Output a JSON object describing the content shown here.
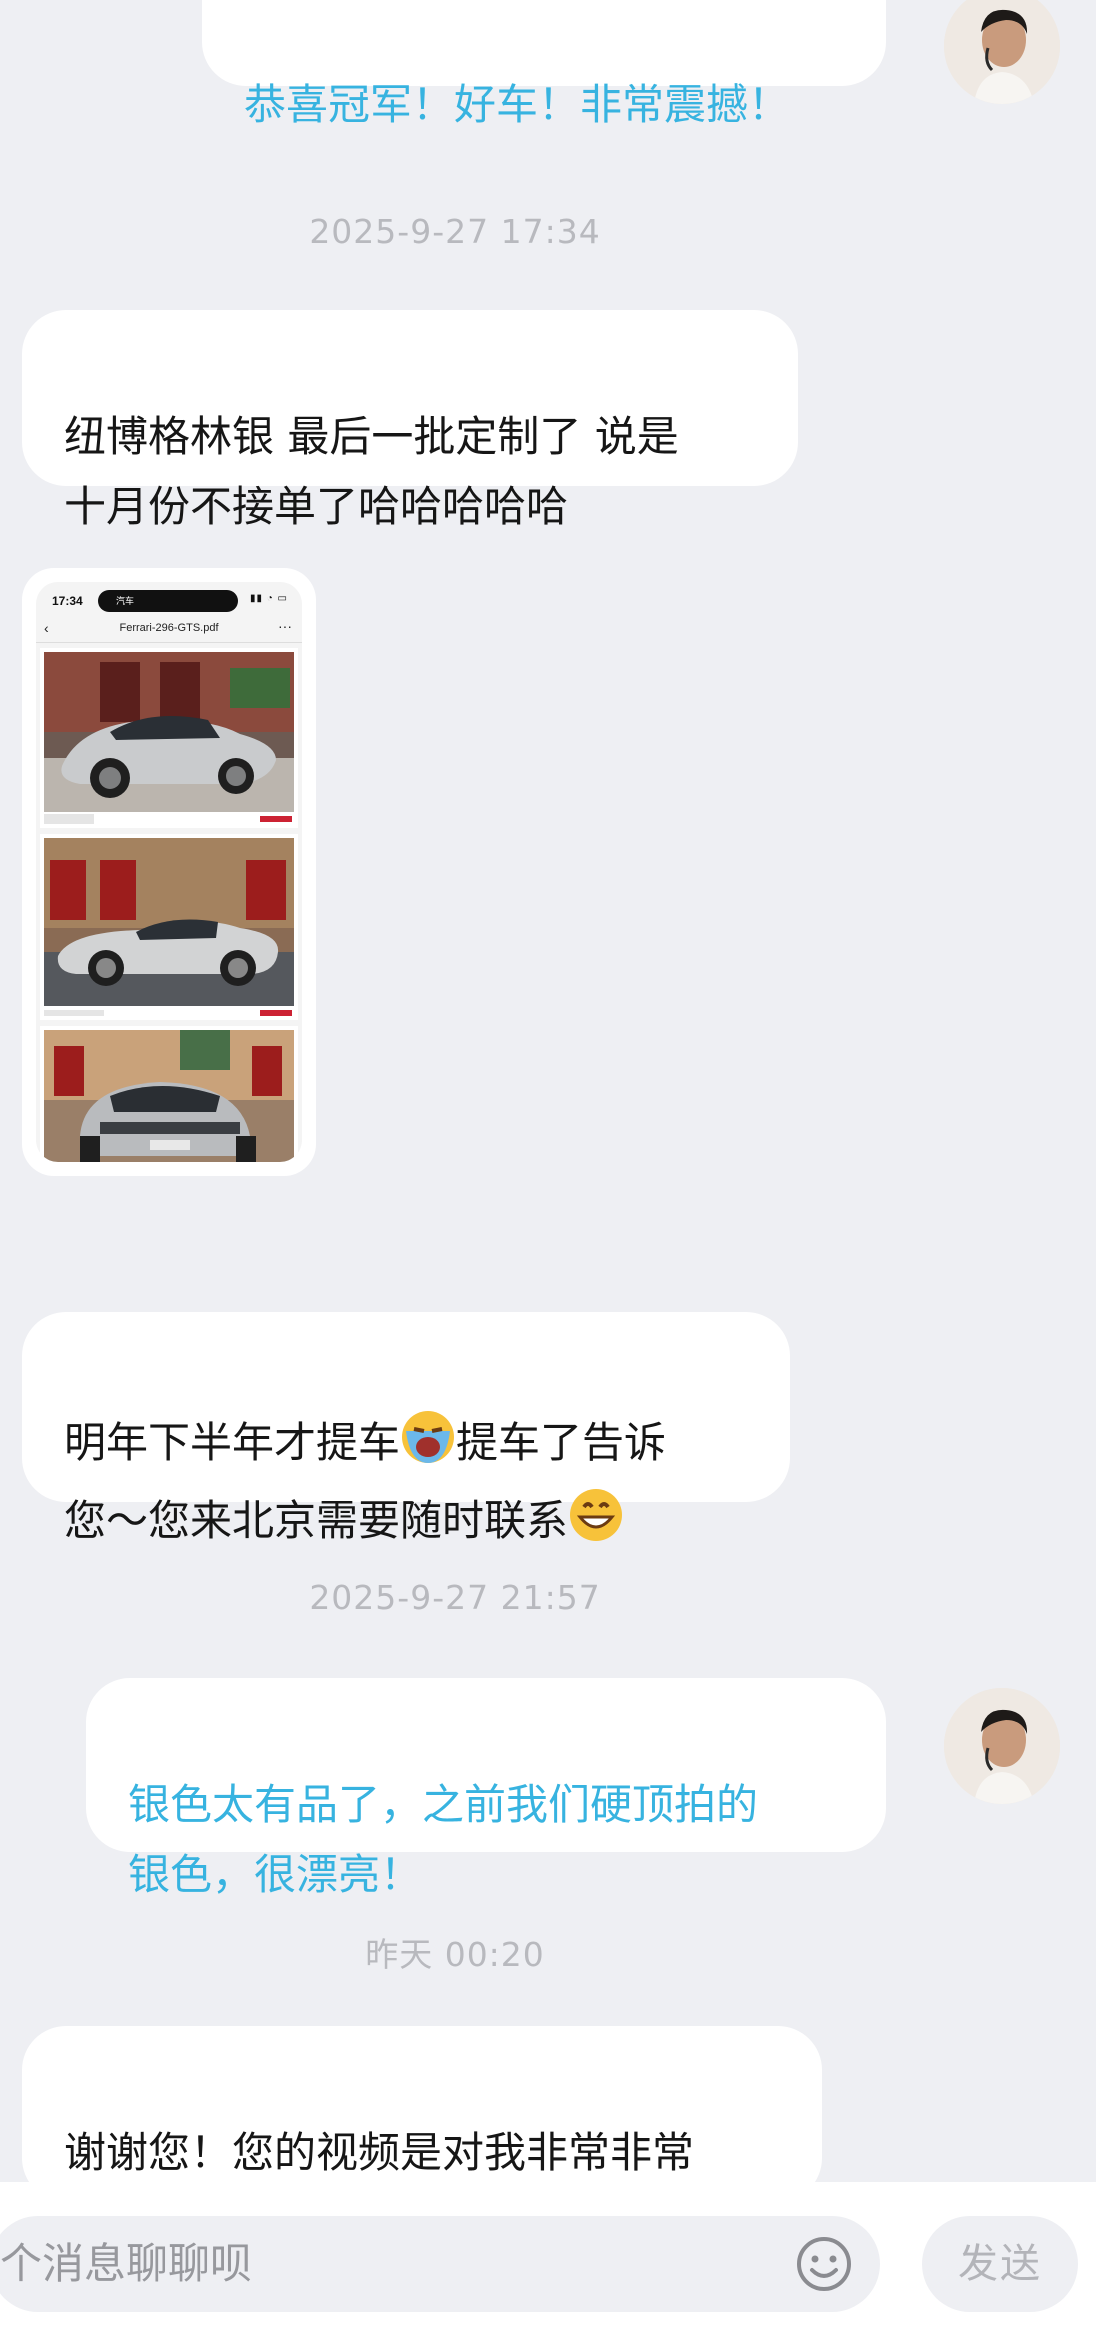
{
  "messages": [
    {
      "type": "text",
      "dir": "out",
      "text": "恭喜冠军！好车！非常震撼！"
    },
    {
      "type": "timestamp",
      "text": "2025-9-27 17:34"
    },
    {
      "type": "text",
      "dir": "in",
      "text": "纽博格林银 最后一批定制了 说是\n十月份不接单了哈哈哈哈哈"
    },
    {
      "type": "image",
      "dir": "in",
      "time": "17:34",
      "island": "汽车",
      "file": "Ferrari-296-GTS.pdf"
    },
    {
      "type": "text",
      "dir": "in",
      "text_a": "明年下半年才提车",
      "text_b": "提车了告诉",
      "text_c": "您～您来北京需要随时联系"
    },
    {
      "type": "timestamp",
      "text": "2025-9-27 21:57"
    },
    {
      "type": "text",
      "dir": "out",
      "text": "银色太有品了，之前我们硬顶拍的\n银色，很漂亮！"
    },
    {
      "type": "timestamp",
      "text": "昨天 00:20"
    },
    {
      "type": "text",
      "dir": "in",
      "text": "谢谢您！您的视频是对我非常非常\n宝贵的参考～"
    }
  ],
  "composer": {
    "placeholder": "个消息聊聊呗",
    "send_label": "发送"
  },
  "icons": {
    "cry": "crying-face-emoji",
    "grin": "grinning-face-emoji",
    "smile": "emoji-button-icon"
  },
  "colors": {
    "background": "#eeeff3",
    "sent_text": "#37b3e0",
    "timestamp": "#b8b9be"
  }
}
